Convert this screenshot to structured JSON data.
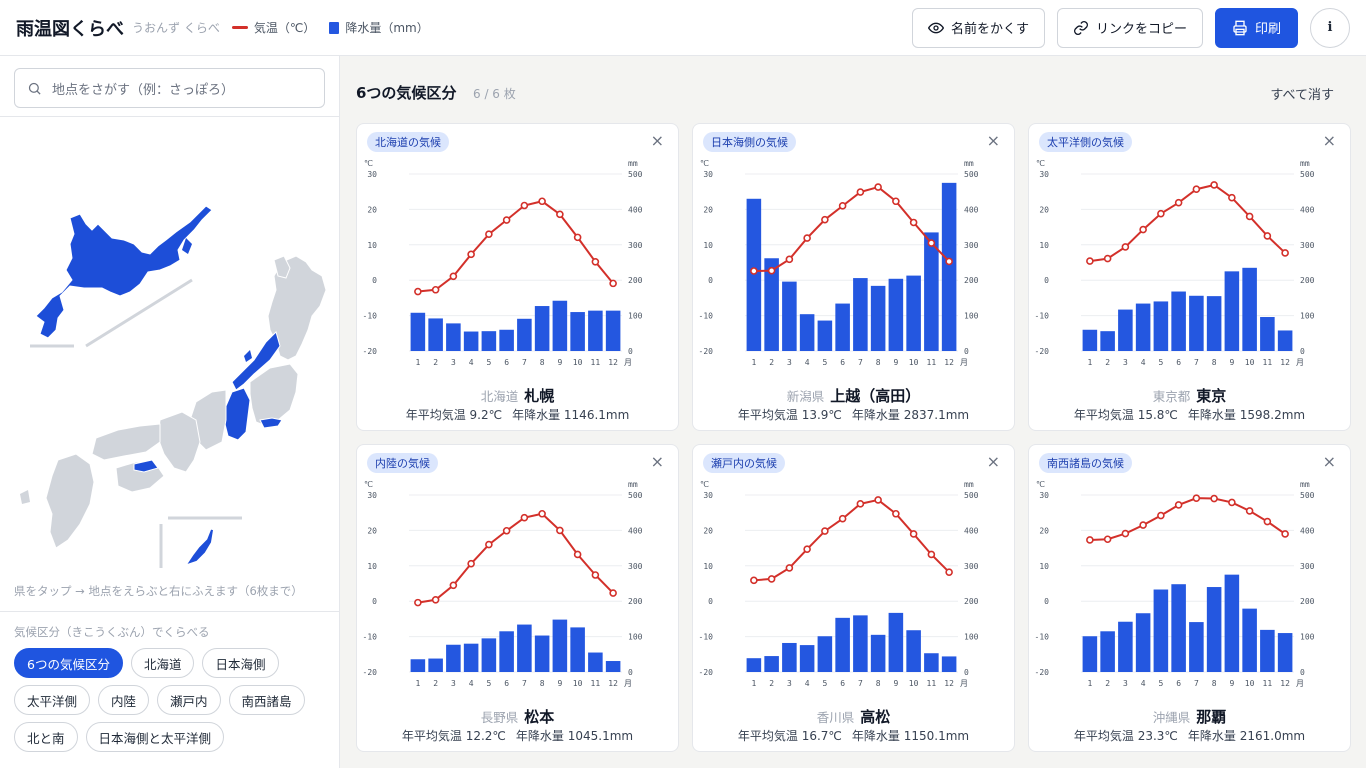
{
  "header": {
    "title": "雨温図くらべ",
    "subtitle": "うおんず くらべ",
    "legend_temp": "気温（℃）",
    "legend_precip": "降水量（mm）",
    "hide_names": "名前をかくす",
    "copy_link": "リンクをコピー",
    "print": "印刷",
    "info": "i"
  },
  "sidebar": {
    "search_placeholder": "地点をさがす（例：さっぽろ）",
    "map_hint": "県をタップ → 地点をえらぶと右にふえます（6枚まで）",
    "kubun_label": "気候区分（きこうくぶん）でくらべる",
    "chips": [
      {
        "label": "6つの気候区分",
        "active": true
      },
      {
        "label": "北海道",
        "active": false
      },
      {
        "label": "日本海側",
        "active": false
      },
      {
        "label": "太平洋側",
        "active": false
      },
      {
        "label": "内陸",
        "active": false
      },
      {
        "label": "瀬戸内",
        "active": false
      },
      {
        "label": "南西諸島",
        "active": false
      },
      {
        "label": "北と南",
        "active": false
      },
      {
        "label": "日本海側と太平洋側",
        "active": false
      }
    ]
  },
  "main": {
    "title": "6つの気候区分",
    "count": "6 / 6 枚",
    "clear_all": "すべて消す"
  },
  "colors": {
    "temp": "#d3302a",
    "precip": "#2457e0",
    "accent": "#1f55e0",
    "highlight": "#1d4ed8",
    "map_gray": "#d1d5db"
  },
  "chart_axes": {
    "temp_unit": "℃",
    "precip_unit": "mm",
    "month_unit": "月",
    "temp_ticks": [
      30,
      20,
      10,
      0,
      -10,
      -20
    ],
    "precip_ticks": [
      500,
      400,
      300,
      200,
      100,
      0
    ],
    "months": [
      "1",
      "2",
      "3",
      "4",
      "5",
      "6",
      "7",
      "8",
      "9",
      "10",
      "11",
      "12"
    ]
  },
  "chart_data": [
    {
      "type": "bar+line",
      "tag": "北海道の気候",
      "pref": "北海道",
      "city": "札幌",
      "avg_temp": "年平均気温 9.2℃",
      "annual_precip": "年降水量 1146.1mm",
      "ylim_temp": [
        -20,
        30
      ],
      "ylim_precip": [
        0,
        500
      ],
      "temperature": [
        -3.2,
        -2.7,
        1.1,
        7.3,
        13.0,
        17.0,
        21.1,
        22.3,
        18.6,
        12.1,
        5.2,
        -0.9
      ],
      "precipitation": [
        108,
        92,
        78,
        55,
        56,
        60,
        91,
        127,
        142,
        110,
        114,
        114
      ]
    },
    {
      "type": "bar+line",
      "tag": "日本海側の気候",
      "pref": "新潟県",
      "city": "上越（高田）",
      "avg_temp": "年平均気温 13.9℃",
      "annual_precip": "年降水量 2837.1mm",
      "ylim_temp": [
        -20,
        30
      ],
      "ylim_precip": [
        0,
        500
      ],
      "temperature": [
        2.6,
        2.7,
        5.9,
        11.9,
        17.1,
        21.0,
        24.9,
        26.3,
        22.3,
        16.3,
        10.5,
        5.3
      ],
      "precipitation": [
        430,
        262,
        196,
        104,
        86,
        134,
        206,
        184,
        204,
        213,
        335,
        475
      ]
    },
    {
      "type": "bar+line",
      "tag": "太平洋側の気候",
      "pref": "東京都",
      "city": "東京",
      "avg_temp": "年平均気温 15.8℃",
      "annual_precip": "年降水量 1598.2mm",
      "ylim_temp": [
        -20,
        30
      ],
      "ylim_precip": [
        0,
        500
      ],
      "temperature": [
        5.4,
        6.1,
        9.4,
        14.3,
        18.8,
        21.9,
        25.7,
        26.9,
        23.3,
        18.0,
        12.5,
        7.7
      ],
      "precipitation": [
        60,
        56,
        117,
        134,
        140,
        168,
        156,
        155,
        225,
        235,
        96,
        58
      ]
    },
    {
      "type": "bar+line",
      "tag": "内陸の気候",
      "pref": "長野県",
      "city": "松本",
      "avg_temp": "年平均気温 12.2℃",
      "annual_precip": "年降水量 1045.1mm",
      "ylim_temp": [
        -20,
        30
      ],
      "ylim_precip": [
        0,
        500
      ],
      "temperature": [
        -0.4,
        0.4,
        4.5,
        10.6,
        16.0,
        19.9,
        23.6,
        24.7,
        20.0,
        13.2,
        7.4,
        2.3
      ],
      "precipitation": [
        36,
        38,
        77,
        80,
        95,
        115,
        134,
        103,
        148,
        126,
        55,
        31
      ]
    },
    {
      "type": "bar+line",
      "tag": "瀬戸内の気候",
      "pref": "香川県",
      "city": "高松",
      "avg_temp": "年平均気温 16.7℃",
      "annual_precip": "年降水量 1150.1mm",
      "ylim_temp": [
        -20,
        30
      ],
      "ylim_precip": [
        0,
        500
      ],
      "temperature": [
        5.9,
        6.3,
        9.4,
        14.7,
        19.8,
        23.3,
        27.5,
        28.6,
        24.7,
        19.0,
        13.2,
        8.2
      ],
      "precipitation": [
        39,
        45,
        82,
        76,
        101,
        153,
        160,
        105,
        167,
        118,
        53,
        44
      ]
    },
    {
      "type": "bar+line",
      "tag": "南西諸島の気候",
      "pref": "沖縄県",
      "city": "那覇",
      "avg_temp": "年平均気温 23.3℃",
      "annual_precip": "年降水量 2161.0mm",
      "ylim_temp": [
        -20,
        30
      ],
      "ylim_precip": [
        0,
        500
      ],
      "temperature": [
        17.3,
        17.5,
        19.1,
        21.5,
        24.2,
        27.2,
        29.1,
        29.0,
        27.9,
        25.5,
        22.5,
        19.0
      ],
      "precipitation": [
        101,
        115,
        142,
        166,
        233,
        248,
        141,
        240,
        275,
        179,
        119,
        110
      ]
    }
  ]
}
